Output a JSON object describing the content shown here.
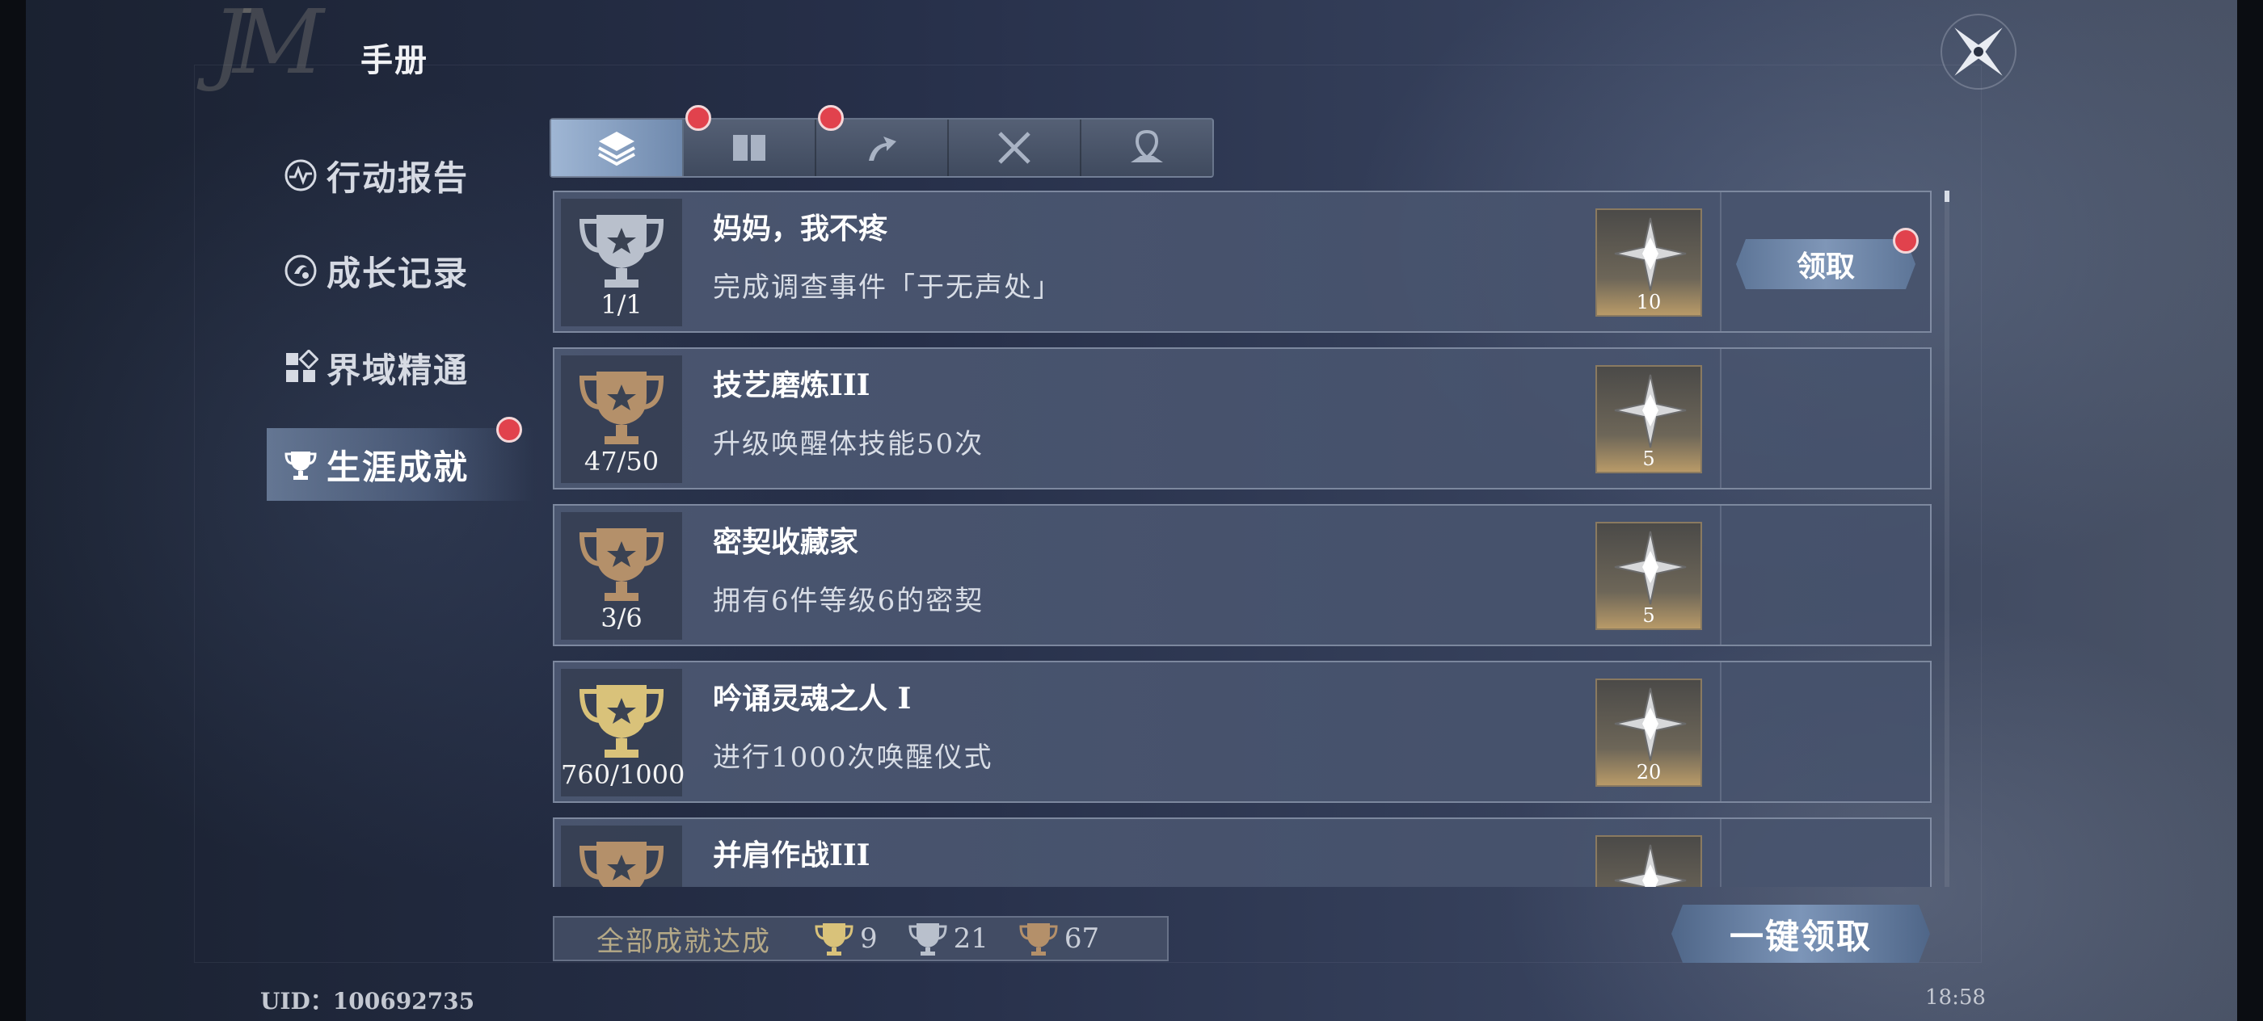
{
  "header": {
    "logo": "JM",
    "title": "手册",
    "close_icon": "compass-close-icon"
  },
  "sidebar": {
    "items": [
      {
        "label": "行动报告",
        "icon": "pulse-icon",
        "active": false,
        "badge": false
      },
      {
        "label": "成长记录",
        "icon": "growth-icon",
        "active": false,
        "badge": false
      },
      {
        "label": "界域精通",
        "icon": "grid-icon",
        "active": false,
        "badge": false
      },
      {
        "label": "生涯成就",
        "icon": "trophy-icon",
        "active": true,
        "badge": true
      }
    ]
  },
  "tabs": [
    {
      "icon": "layers-icon",
      "active": true,
      "badge": true
    },
    {
      "icon": "book-icon",
      "active": false,
      "badge": true
    },
    {
      "icon": "arrow-up-icon",
      "active": false,
      "badge": false
    },
    {
      "icon": "crossed-swords-icon",
      "active": false,
      "badge": false
    },
    {
      "icon": "map-pin-icon",
      "active": false,
      "badge": false
    }
  ],
  "achievements": [
    {
      "title": "妈妈，我不疼",
      "desc": "完成调查事件「于无声处」",
      "progress": "1/1",
      "tier": "silver",
      "reward_count": "10",
      "claim_label": "领取",
      "claimable": true
    },
    {
      "title": "技艺磨炼III",
      "desc": "升级唤醒体技能50次",
      "progress": "47/50",
      "tier": "bronze",
      "reward_count": "5",
      "claimable": false
    },
    {
      "title": "密契收藏家",
      "desc": "拥有6件等级6的密契",
      "progress": "3/6",
      "tier": "bronze",
      "reward_count": "5",
      "claimable": false
    },
    {
      "title": "吟诵灵魂之人 I",
      "desc": "进行1000次唤醒仪式",
      "progress": "760/1000",
      "tier": "gold",
      "reward_count": "20",
      "claimable": false
    },
    {
      "title": "并肩作战III",
      "desc": "",
      "progress": "",
      "tier": "bronze",
      "reward_count": "",
      "claimable": false
    }
  ],
  "summary": {
    "label": "全部成就达成",
    "gold": "9",
    "silver": "21",
    "bronze": "67"
  },
  "claim_all_label": "一键领取",
  "footer": {
    "uid": "UID：100692735",
    "time": "18:58"
  },
  "colors": {
    "gold": "#d9c27a",
    "silver": "#b9c0cc",
    "bronze": "#b4906a",
    "badge": "#e1424d"
  }
}
